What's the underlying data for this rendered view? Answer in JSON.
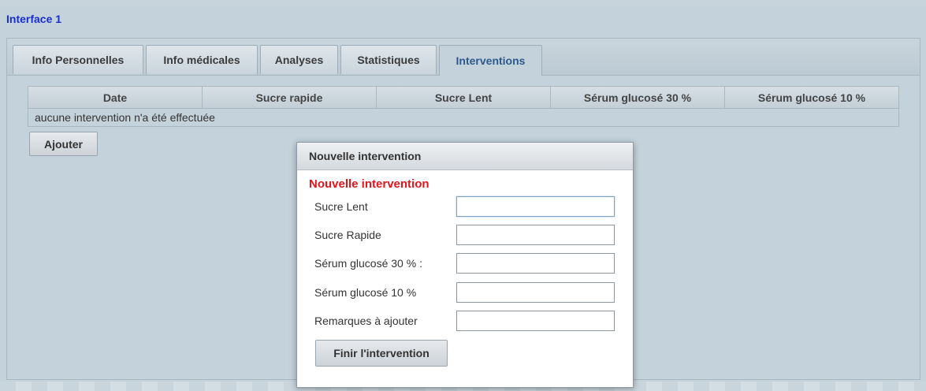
{
  "app": {
    "title": "Interface 1"
  },
  "tabs": [
    {
      "label": "Info Personnelles"
    },
    {
      "label": "Info médicales"
    },
    {
      "label": "Analyses"
    },
    {
      "label": "Statistiques"
    },
    {
      "label": "Interventions",
      "active": true
    }
  ],
  "grid": {
    "columns": [
      "Date",
      "Sucre rapide",
      "Sucre Lent",
      "Sérum glucosé 30 %",
      "Sérum glucosé 10 %"
    ],
    "empty_message": "aucune intervention n'a été effectuée"
  },
  "actions": {
    "add_label": "Ajouter"
  },
  "dialog": {
    "title": "Nouvelle intervention",
    "heading": "Nouvelle intervention",
    "heading_color": "#e3141b",
    "fields": [
      {
        "label": "Sucre Lent",
        "value": ""
      },
      {
        "label": "Sucre Rapide",
        "value": ""
      },
      {
        "label": "Sérum glucosé 30 % :",
        "value": ""
      },
      {
        "label": "Sérum glucosé 10 %",
        "value": ""
      },
      {
        "label": "Remarques à ajouter",
        "value": ""
      }
    ],
    "submit_label": "Finir l'intervention"
  },
  "colors": {
    "title_link": "#1a2fc9",
    "active_tab_text": "#2d5a8a",
    "background": "#c4d2db"
  }
}
